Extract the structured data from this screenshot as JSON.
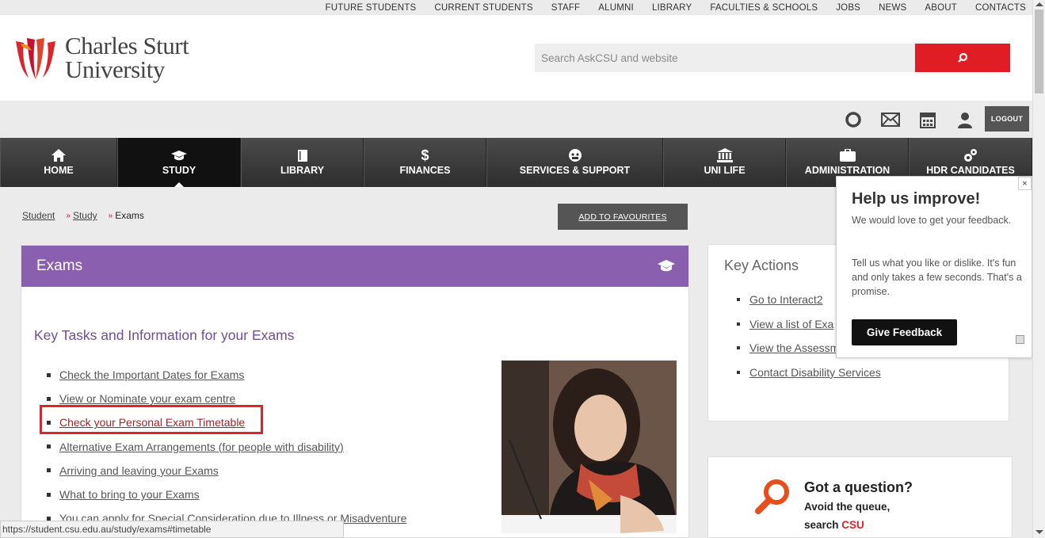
{
  "toplinks": [
    "FUTURE STUDENTS",
    "CURRENT STUDENTS",
    "STAFF",
    "ALUMNI",
    "LIBRARY",
    "FACULTIES & SCHOOLS",
    "JOBS",
    "NEWS",
    "ABOUT",
    "CONTACTS"
  ],
  "header": {
    "logo_line1": "Charles Sturt",
    "logo_line2": "University",
    "search_placeholder": "Search AskCSU and website"
  },
  "utility": {
    "logout": "LOGOUT"
  },
  "nav": {
    "items": [
      {
        "label": "HOME",
        "icon": "home-icon"
      },
      {
        "label": "STUDY",
        "icon": "graduation-cap-icon"
      },
      {
        "label": "LIBRARY",
        "icon": "book-icon"
      },
      {
        "label": "FINANCES",
        "icon": "dollar-icon"
      },
      {
        "label": "SERVICES & SUPPORT",
        "icon": "support-icon"
      },
      {
        "label": "UNI LIFE",
        "icon": "building-icon"
      },
      {
        "label": "ADMINISTRATION",
        "icon": "briefcase-icon"
      },
      {
        "label": "HDR CANDIDATES",
        "icon": "gears-icon"
      }
    ]
  },
  "breadcrumb": {
    "level1": "Student",
    "level2": "Study",
    "current": "Exams"
  },
  "favourites": "ADD TO FAVOURITES",
  "panel": {
    "title": "Exams",
    "subtitle": "Key Tasks and Information for your Exams",
    "tasks": [
      "Check the Important Dates for Exams",
      "View or Nominate your exam centre",
      "Check your Personal Exam Timetable",
      "Alternative Exam Arrangements (for people with disability)",
      "Arriving and leaving your Exams",
      "What to bring to your Exams",
      "You can apply for Special Consideration due to Illness or Misadventure"
    ]
  },
  "actions": {
    "title": "Key Actions",
    "items": [
      "Go to Interact2",
      "View a list of Exa",
      "View the Assessm",
      "Contact Disability Services"
    ]
  },
  "question": {
    "title": "Got a question?",
    "line1": "Avoid the queue,",
    "line2_prefix": "search ",
    "line2_brand": "CSU"
  },
  "feedback": {
    "title": "Help us improve!",
    "text1": "We would love to get your feedback.",
    "text2": "Tell us what you like or dislike. It's fun and only takes a few seconds. That's a promise.",
    "button": "Give Feedback",
    "close": "×"
  },
  "status": "https://student.csu.edu.au/study/exams#timetable",
  "colors": {
    "brand_red": "#e01c24",
    "purple": "#8a5fb0",
    "nav_dark": "#333333"
  }
}
